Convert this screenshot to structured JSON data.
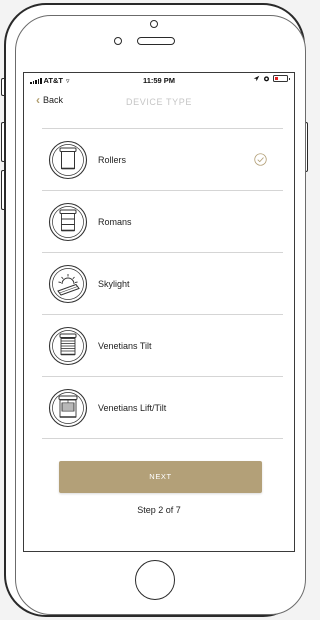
{
  "status_bar": {
    "carrier": "AT&T",
    "time": "11:59 PM"
  },
  "nav": {
    "back_label": "Back",
    "title": "DEVICE TYPE"
  },
  "device_types": [
    {
      "label": "Rollers",
      "icon": "roller-blind-icon",
      "selected": true
    },
    {
      "label": "Romans",
      "icon": "roman-blind-icon",
      "selected": false
    },
    {
      "label": "Skylight",
      "icon": "skylight-icon",
      "selected": false
    },
    {
      "label": "Venetians Tilt",
      "icon": "venetian-tilt-icon",
      "selected": false
    },
    {
      "label": "Venetians Lift/Tilt",
      "icon": "venetian-lift-tilt-icon",
      "selected": false
    }
  ],
  "next_button": {
    "label": "NEXT"
  },
  "step": {
    "text": "Step 2 of 7"
  },
  "colors": {
    "accent": "#b3a078",
    "title_gray": "#c5c5c5",
    "divider": "#d5d5d5",
    "battery_low": "#e02020"
  }
}
